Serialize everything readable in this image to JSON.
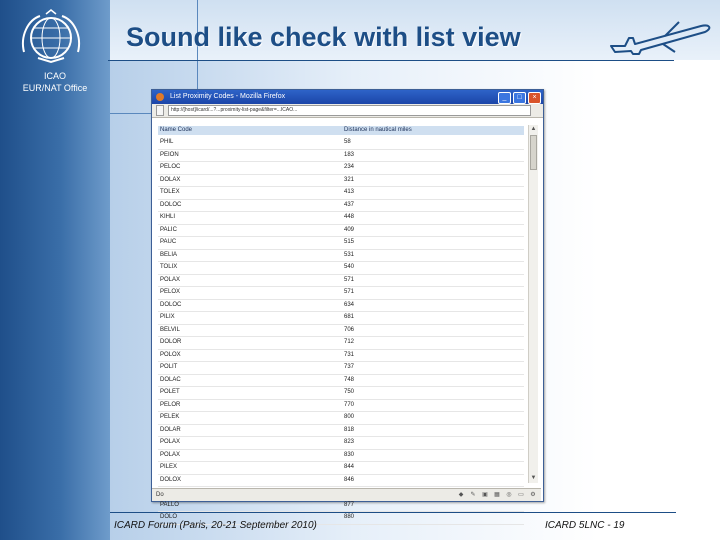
{
  "slide": {
    "title": "Sound like check with list view",
    "org_line1": "ICAO",
    "org_line2": "EUR/NAT Office",
    "footer_left": "ICARD Forum (Paris, 20-21 September 2010)",
    "footer_right": "ICARD 5LNC - 19"
  },
  "browser": {
    "window_title": "List Proximity Codes - Mozilla Firefox",
    "url": "http://[host]/icard/...?...proximity-list-page&filter=...ICAO...",
    "url_button": "",
    "status_text": "Do",
    "columns": [
      "Name Code",
      "Distance in nautical miles"
    ],
    "rows": [
      [
        "PHIL",
        "58"
      ],
      [
        "PEION",
        "183"
      ],
      [
        "PELOC",
        "234"
      ],
      [
        "DOLAX",
        "321"
      ],
      [
        "TOLEX",
        "413"
      ],
      [
        "DOLOC",
        "437"
      ],
      [
        "KIHLI",
        "448"
      ],
      [
        "PALIC",
        "409"
      ],
      [
        "PAUC",
        "515"
      ],
      [
        "BELIA",
        "531"
      ],
      [
        "TOLIX",
        "540"
      ],
      [
        "POLAX",
        "571"
      ],
      [
        "PELOX",
        "571"
      ],
      [
        "DOLOC",
        "634"
      ],
      [
        "PILIX",
        "681"
      ],
      [
        "BELVIL",
        "706"
      ],
      [
        "DOLOR",
        "712"
      ],
      [
        "POLOX",
        "731"
      ],
      [
        "POLIT",
        "737"
      ],
      [
        "DOLAC",
        "748"
      ],
      [
        "POLET",
        "750"
      ],
      [
        "PELOR",
        "770"
      ],
      [
        "PELEK",
        "800"
      ],
      [
        "DOLAR",
        "818"
      ],
      [
        "POLAX",
        "823"
      ],
      [
        "POLAX",
        "830"
      ],
      [
        "PILEX",
        "844"
      ],
      [
        "DOLOX",
        "846"
      ],
      [
        "DOLAR",
        "861"
      ],
      [
        "PALLO",
        "877"
      ],
      [
        "DOLO",
        "880"
      ]
    ]
  },
  "colors": {
    "title": "#1d4e86",
    "sidebar": "#2b5c96",
    "header_row": "#cfdff0"
  },
  "icons": [
    "icao-logo",
    "airplane-icon",
    "firefox-icon"
  ]
}
